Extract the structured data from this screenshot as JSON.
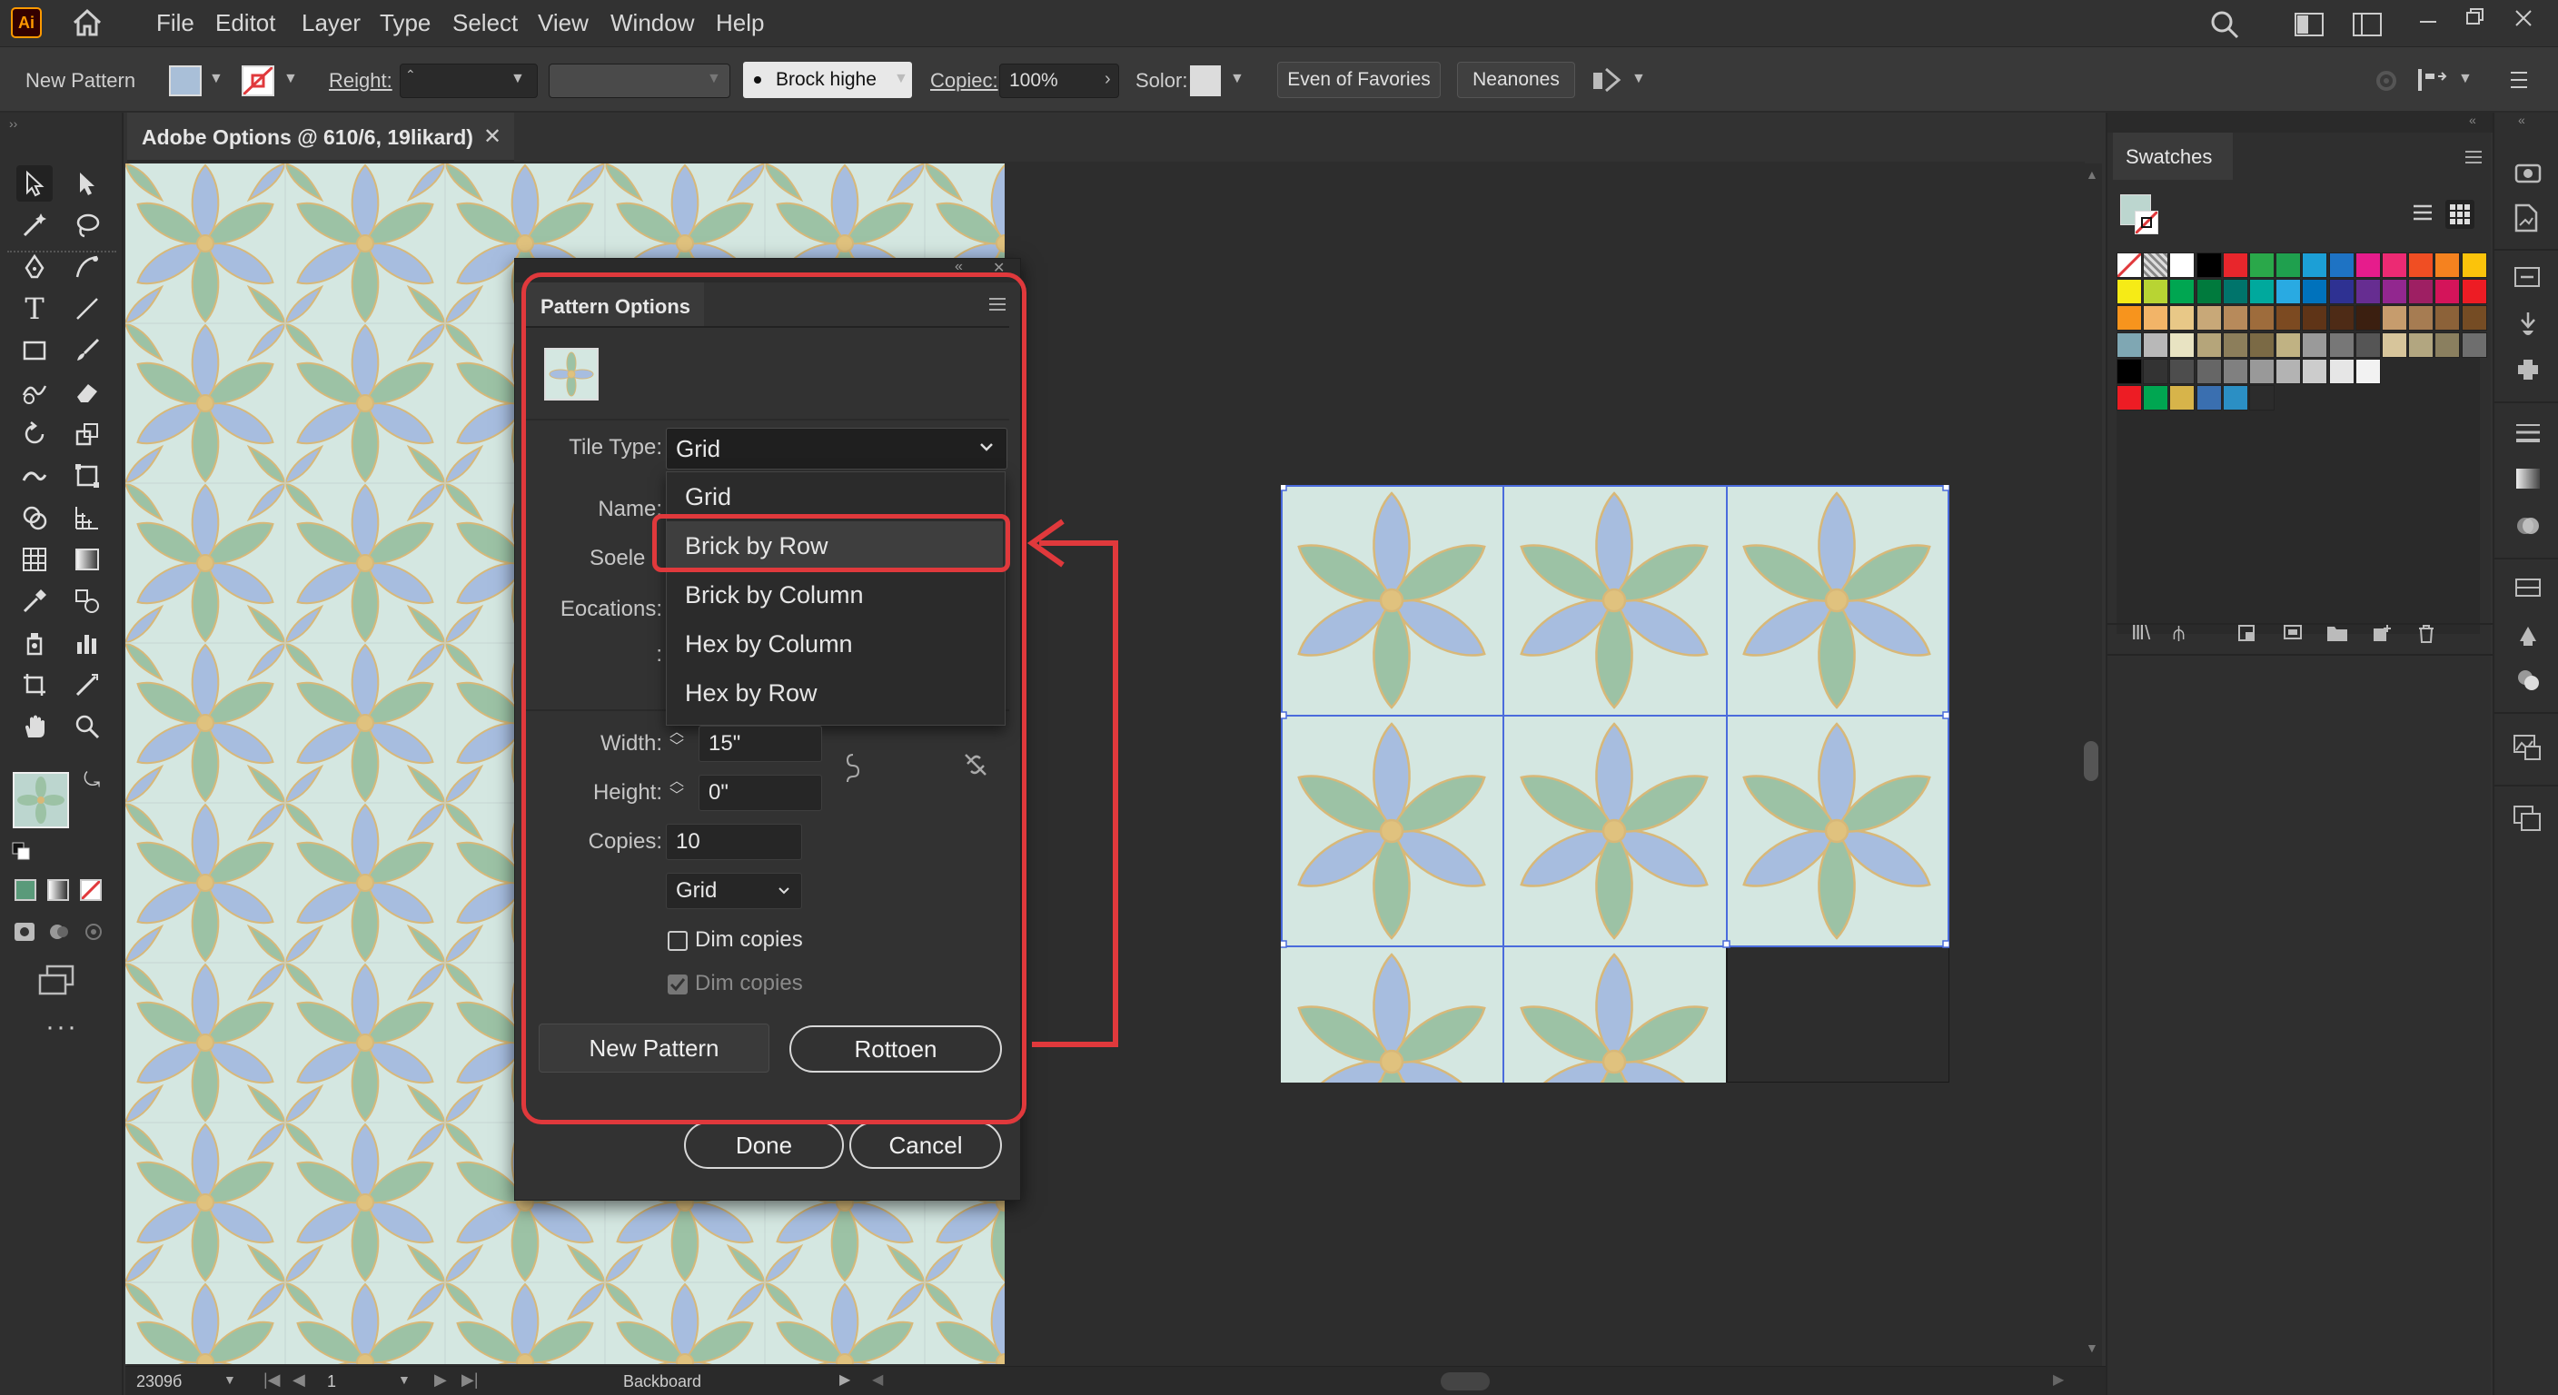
{
  "app": {
    "logo": "Ai"
  },
  "menu": [
    "File",
    "Editot",
    "Layer",
    "Type",
    "Select",
    "View",
    "Window",
    "Help"
  ],
  "control_bar": {
    "mode_label": "New Pattern",
    "reight_label": "Reight:",
    "brush_value": "Brock highe",
    "copies_label": "Copiec:",
    "copies_value": "100%",
    "solor_label": "Solor:",
    "btn_favorites": "Even of Favories",
    "btn_neanones": "Neanones"
  },
  "document": {
    "tab_title": "Adobe Options @ 610/6, 19likard)"
  },
  "dialog": {
    "title": "Pattern Options",
    "tile_type_label": "Tile Type:",
    "tile_type_value": "Grid",
    "name_label": "Name:",
    "soele_label": "Soele",
    "eocations_label": "Eocations:",
    "colon_label": ":",
    "dropdown_options": [
      "Grid",
      "Brick by Row",
      "Brick by Column",
      "Hex by Column",
      "Hex by Row"
    ],
    "highlighted_option": "Brick by Row",
    "width_label": "Width:",
    "width_value": "15\"",
    "height_label": "Height:",
    "height_value": "0\"",
    "copies_label": "Copies:",
    "copies_value": "10",
    "overlap_value": "Grid",
    "dim_copies_1": "Dim copies",
    "dim_copies_2": "Dim copies",
    "dim_copies_1_checked": false,
    "dim_copies_2_checked": true,
    "btn_new_pattern": "New Pattern",
    "btn_rottoen": "Rottoen",
    "btn_done": "Done",
    "btn_cancel": "Cancel"
  },
  "swatches_panel": {
    "title": "Swatches",
    "rows": [
      [
        "none",
        "reg",
        "#ffffff",
        "#000000",
        "#e8262c",
        "#2aa84a",
        "#1fa04e",
        "#1c9fd6",
        "#1e73c4",
        "#e61c8c",
        "#ec2a73",
        "#f04e23",
        "#f5821f",
        "#fbc30b"
      ],
      [
        "#f6eb16",
        "#b8d433",
        "#00a651",
        "#007a3d",
        "#00746b",
        "#00a99d",
        "#29aae2",
        "#0072bc",
        "#2e3192",
        "#662d91",
        "#92278f",
        "#9e1f63",
        "#d4145a",
        "#ed1c24"
      ],
      [
        "#f7941d",
        "#f2b468",
        "#e8c887",
        "#c8a878",
        "#b78a5b",
        "#9e6c3c",
        "#7c4a21",
        "#5f3417",
        "#4e2b16",
        "#3b1f10",
        "#c69c6d",
        "#a67c52",
        "#8c6239",
        "#754c24"
      ],
      [
        "#7fa7b3",
        "#b8b8b8",
        "#e8e3c2",
        "#b5a57a",
        "#8c7e5b",
        "#7b6a45",
        "#c0b283",
        "#9a9a9a",
        "#777777",
        "#555555",
        "#d7c59b",
        "#b2a680",
        "#8a7f5f",
        "#6e6e6e"
      ],
      [
        "#000000",
        "#333333",
        "#4d4d4d",
        "#666666",
        "#808080",
        "#999999",
        "#b3b3b3",
        "#cccccc",
        "#e6e6e6",
        "#f2f2f2"
      ],
      [
        "#ed1c24",
        "#00a651",
        "#d7b44a",
        "#3a6fb0",
        "#2b8fc4",
        "#2c2c2c"
      ]
    ]
  },
  "status_bar": {
    "zoom": "2309б",
    "page": "1",
    "label": "Backboard"
  },
  "colors": {
    "accent_red": "#e0393c",
    "selection_blue": "#4a6bdc",
    "petal_blue": "#a7bddf",
    "petal_green": "#9cc2a5",
    "tile_bg": "#d4e7e1",
    "gold": "#d8b878"
  }
}
